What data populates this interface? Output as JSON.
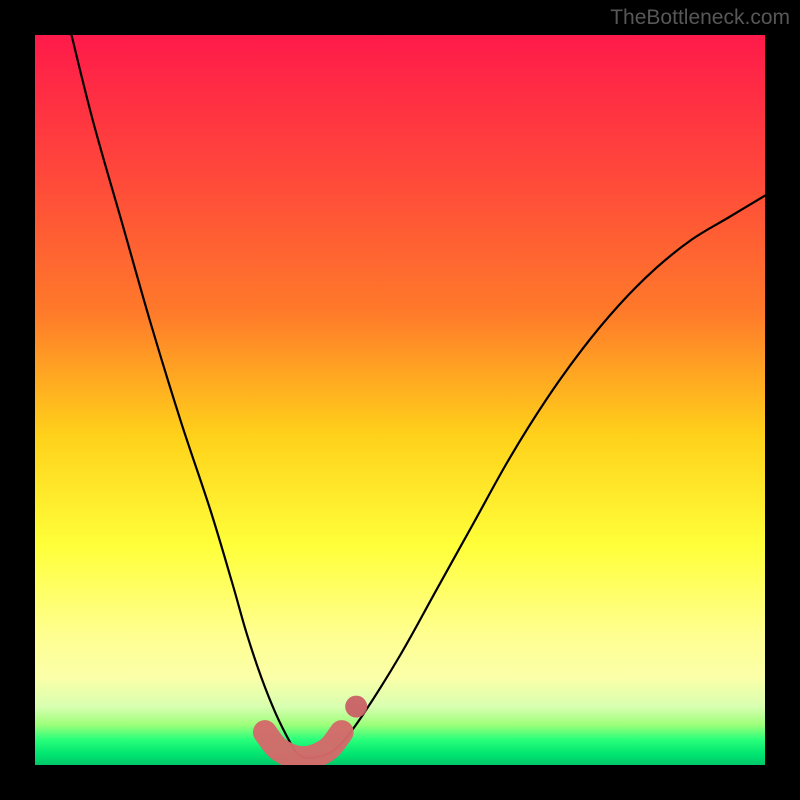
{
  "watermark": "TheBottleneck.com",
  "colors": {
    "bg_black": "#000000",
    "grad_top": "#ff1a4a",
    "grad_mid1": "#ff7a2a",
    "grad_mid2": "#ffd21a",
    "grad_mid3": "#ffff3a",
    "grad_low": "#fbffa8",
    "grad_green1": "#9dff7a",
    "grad_green2": "#2aff7a",
    "grad_green3": "#00e571",
    "curve": "#000000",
    "marker_fill": "#d46a6a",
    "marker_fill2": "#c96065"
  },
  "chart_data": {
    "type": "line",
    "title": "",
    "xlabel": "",
    "ylabel": "",
    "xlim": [
      0,
      100
    ],
    "ylim": [
      0,
      100
    ],
    "series": [
      {
        "name": "bottleneck-curve",
        "x": [
          5,
          8,
          12,
          16,
          20,
          24,
          27,
          29,
          31,
          33,
          35,
          36,
          37,
          38,
          40,
          42,
          45,
          50,
          55,
          60,
          65,
          70,
          75,
          80,
          85,
          90,
          95,
          100
        ],
        "y": [
          100,
          88,
          74,
          60,
          47,
          35,
          25,
          18,
          12,
          7,
          3,
          1.5,
          1,
          1,
          1.5,
          3,
          7,
          15,
          24,
          33,
          42,
          50,
          57,
          63,
          68,
          72,
          75,
          78
        ]
      }
    ],
    "markers": {
      "name": "highlight-band",
      "x": [
        31.5,
        33,
        34.5,
        36,
        37.5,
        39,
        40.5,
        42
      ],
      "y": [
        4.5,
        2.5,
        1.5,
        1,
        1,
        1.5,
        2.5,
        4.5
      ]
    },
    "extra_marker": {
      "x": 44,
      "y": 8
    }
  }
}
